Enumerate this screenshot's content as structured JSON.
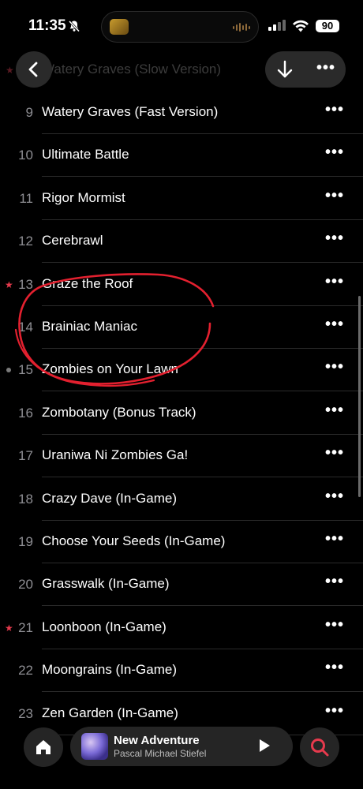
{
  "status_bar": {
    "time": "11:35",
    "battery": "90",
    "icons": [
      "bell-slash-icon",
      "cellular-signal-icon",
      "wifi-icon",
      "battery-icon"
    ]
  },
  "ghost_rows": [
    {
      "number": "",
      "title": "Watery Graves (Slow Version)"
    }
  ],
  "header": {
    "back_icon": "chevron-left-icon",
    "download_icon": "arrow-down-icon",
    "more_icon": "ellipsis-icon",
    "more_label": "•••"
  },
  "tracks": [
    {
      "number": "9",
      "title": "Watery Graves (Fast Version)",
      "marker": ""
    },
    {
      "number": "10",
      "title": "Ultimate Battle",
      "marker": ""
    },
    {
      "number": "11",
      "title": "Rigor Mormist",
      "marker": ""
    },
    {
      "number": "12",
      "title": "Cerebrawl",
      "marker": ""
    },
    {
      "number": "13",
      "title": "Graze the Roof",
      "marker": "star"
    },
    {
      "number": "14",
      "title": "Brainiac Maniac",
      "marker": ""
    },
    {
      "number": "15",
      "title": "Zombies on Your Lawn",
      "marker": "dot"
    },
    {
      "number": "16",
      "title": "Zombotany (Bonus Track)",
      "marker": ""
    },
    {
      "number": "17",
      "title": "Uraniwa Ni Zombies Ga!",
      "marker": ""
    },
    {
      "number": "18",
      "title": "Crazy Dave (In-Game)",
      "marker": ""
    },
    {
      "number": "19",
      "title": "Choose Your Seeds (In-Game)",
      "marker": ""
    },
    {
      "number": "20",
      "title": "Grasswalk (In-Game)",
      "marker": ""
    },
    {
      "number": "21",
      "title": "Loonboon (In-Game)",
      "marker": "star"
    },
    {
      "number": "22",
      "title": "Moongrains (In-Game)",
      "marker": ""
    },
    {
      "number": "23",
      "title": "Zen Garden (In-Game)",
      "marker": ""
    }
  ],
  "row_more_label": "•••",
  "star_glyph": "★",
  "annotation": {
    "color": "#e3202f",
    "shape": "hand-drawn-circle"
  },
  "mini_player": {
    "title": "New Adventure",
    "artist": "Pascal Michael Stiefel",
    "play_icon": "play-icon"
  },
  "nav": {
    "home_icon": "home-icon",
    "search_icon": "search-icon"
  },
  "colors": {
    "accent": "#e63a4d",
    "background": "#000000",
    "secondary_text": "#8e8e93"
  }
}
